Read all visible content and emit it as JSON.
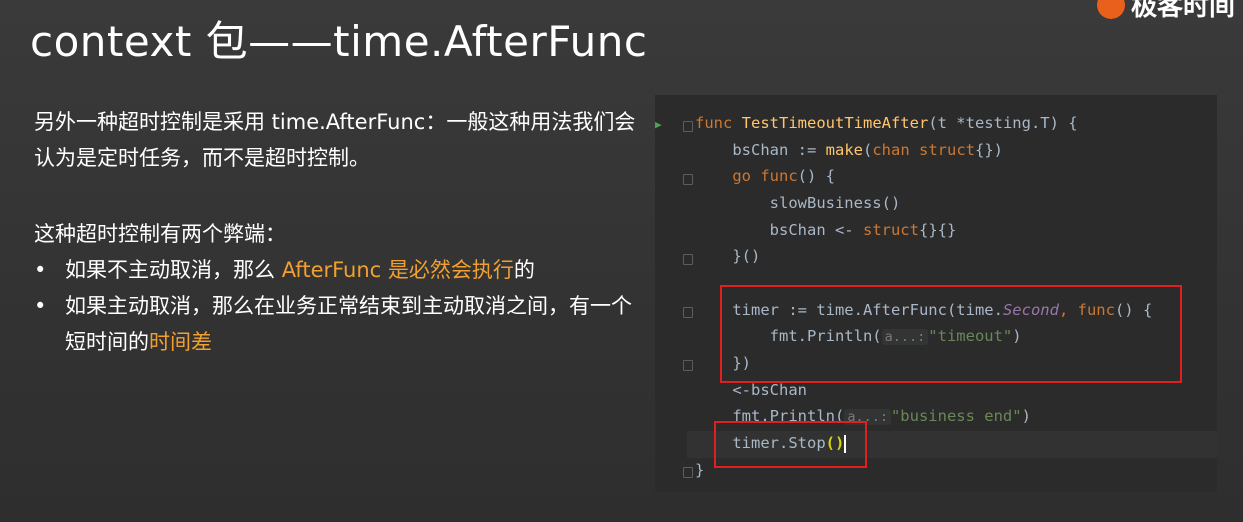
{
  "title": "context 包——time.AfterFunc",
  "logo": {
    "text": "极客时间"
  },
  "description": {
    "intro": "另外一种超时控制是采用 time.AfterFunc：一般这种用法我们会认为是定时任务，而不是超时控制。",
    "drawbacks_title": "这种超时控制有两个弊端：",
    "bullets": [
      {
        "prefix": "如果不主动取消，那么 ",
        "highlight": "AfterFunc 是必然会执行",
        "suffix": "的"
      },
      {
        "prefix": "如果主动取消，那么在业务正常结束到主动取消之间，有一个短时间的",
        "highlight": "时间差",
        "suffix": ""
      }
    ]
  },
  "code": {
    "func_kw": "func",
    "func_name": "TestTimeoutTimeAfter",
    "params": "(t *testing.T) {",
    "bs_lhs": "bsChan := ",
    "make_kw": "make",
    "chan_kw": "chan",
    "struct_kw": "struct",
    "go_kw": "go",
    "slow_business": "slowBusiness()",
    "send_stmt": "bsChan <- ",
    "close_go": "}()",
    "timer_lhs": "timer := time.AfterFunc(time.",
    "second": "Second",
    "fmt_println": "fmt.Println(",
    "hint": "a...:",
    "timeout_str": "\"timeout\"",
    "close_after": "})",
    "recv_stmt": "<-bsChan",
    "business_end_str": "\"business end\"",
    "timer_stop": "timer.Stop",
    "close_brace": "}"
  },
  "colors": {
    "background": "#333333",
    "code_background": "#2b2b2b",
    "highlight": "#f0a030",
    "keyword": "#cc7832",
    "function_name": "#ffc66d",
    "string": "#6a8759",
    "constant": "#9876aa",
    "box": "#e02020"
  }
}
